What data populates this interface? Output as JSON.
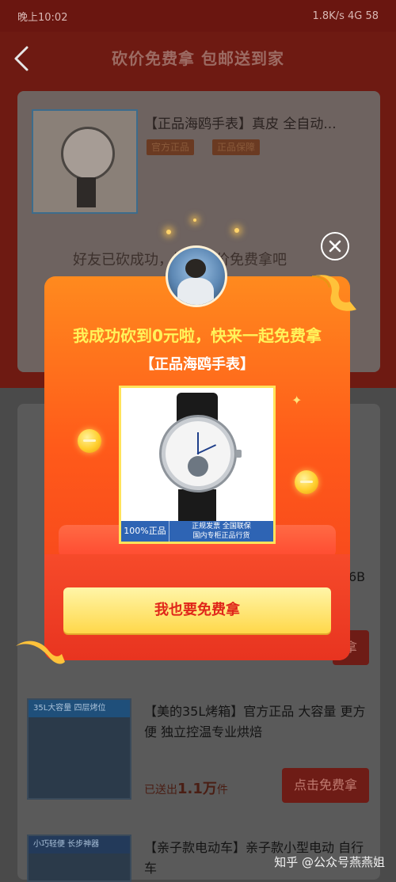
{
  "status_bar": {
    "time": "晚上10:02",
    "right": "1.8K/s  4G  58"
  },
  "header": {
    "title": "砍价免费拿 包邮送到家"
  },
  "background_card": {
    "product_title": "【正品海鸥手表】真皮 全自动...",
    "tags": [
      "官方正品",
      "正品保障"
    ],
    "friend_text": "好友已砍成功，快来砍价免费拿吧"
  },
  "background_list": {
    "items": [
      {
        "title": "【美的35L烤箱】官方正品 大容量 更方便 独立控温专业烘焙",
        "sold_prefix": "已送出",
        "sold_count": "1.1万",
        "sold_suffix": "件",
        "button": "点击免费拿",
        "img_band": "35L大容量 四层烤位"
      },
      {
        "title": "【亲子款电动车】亲子款小型电动 自行车",
        "img_band": "小巧轻便 长步神器"
      }
    ],
    "partial_right": "6B",
    "partial_button": "拿"
  },
  "popup": {
    "headline": "我成功砍到0元啦，快来一起免费拿",
    "product_name": "【正品海鸥手表】",
    "guarantee_left": "100%正品",
    "guarantee_right_line1": "正规发票 全国联保",
    "guarantee_right_line2": "国内专柜正品行货",
    "cta": "我也要免费拿",
    "close_icon": "close-icon"
  },
  "watermark": "知乎 @公众号燕燕姐",
  "colors": {
    "accent_red": "#e0261a",
    "cta_yellow": "#ffd84a",
    "headline_yellow": "#fff35a"
  }
}
